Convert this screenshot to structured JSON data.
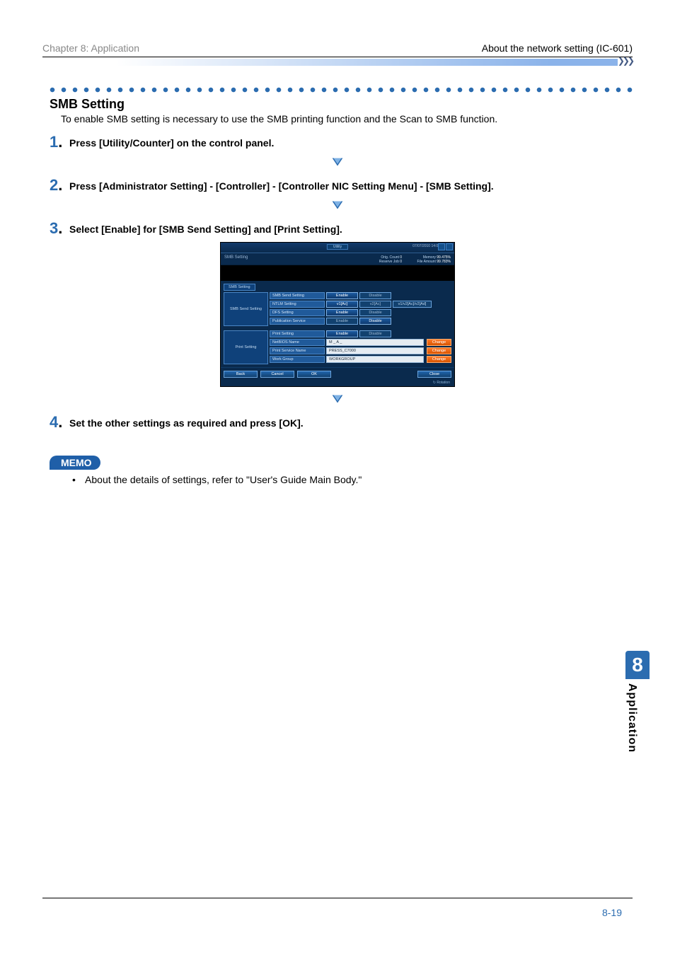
{
  "meta": {
    "chapter_label": "Chapter 8: Application",
    "header_right": "About the network setting (IC-601)"
  },
  "section": {
    "title": "SMB Setting",
    "description": "To enable SMB setting is necessary to use the SMB printing function and the Scan to SMB function."
  },
  "steps": {
    "s1": {
      "n": "1",
      "dot": ".",
      "text": "Press [Utility/Counter] on the control panel."
    },
    "s2": {
      "n": "2",
      "dot": ".",
      "text": "Press [Administrator Setting] - [Controller] - [Controller NIC Setting Menu] - [SMB Setting]."
    },
    "s3": {
      "n": "3",
      "dot": ".",
      "text": "Select [Enable] for [SMB Send Setting] and [Print Setting]."
    },
    "s4": {
      "n": "4",
      "dot": ".",
      "text": "Set the other settings as required and press [OK]."
    }
  },
  "memo": {
    "badge": "MEMO",
    "bullet": "About the details of settings, refer to \"User's Guide Main Body.\""
  },
  "side": {
    "number": "8",
    "label": "Application"
  },
  "footer": {
    "page": "8-19"
  },
  "screenshot": {
    "topbar": {
      "tab": "Utility",
      "date": "07/07/2010 14:00"
    },
    "header": {
      "breadcrumb": "SMB Setting",
      "stats": {
        "r1k": "Orig. Count",
        "r1v1": "0",
        "r1m": "Memory",
        "r1v2": "99.475%",
        "r2k": "Reserve Job",
        "r2v1": "0",
        "r2m": "File Amount",
        "r2v2": "99.783%"
      }
    },
    "left_tab": "SMB Setting",
    "group1": {
      "cap": "SMB Send Setting",
      "rows": {
        "r1": {
          "label": "SMB Send Setting",
          "b1": "Enable",
          "b2": "Disable"
        },
        "r2": {
          "label": "NTLM Setting",
          "b1": "v1[Ac]",
          "b2": "v2[Ac]",
          "b3": "v1/v2[Ac]/v2[Ad]"
        },
        "r3": {
          "label": "DFS Setting",
          "b1": "Enable",
          "b2": "Disable"
        },
        "r4": {
          "label": "Publication Service",
          "b1": "Enable",
          "b2": "Disable"
        }
      }
    },
    "group2": {
      "cap": "Print Setting",
      "rows": {
        "r1": {
          "label": "Print Setting",
          "b1": "Enable",
          "b2": "Disable"
        },
        "r2": {
          "label": "NetBIOS Name",
          "input": "M _ A _",
          "change": "Change"
        },
        "r3": {
          "label": "Print Service Name",
          "input": "PRESS_C7000",
          "change": "Change"
        },
        "r4": {
          "label": "Work Group",
          "input": "WORKGROUP",
          "change": "Change"
        }
      }
    },
    "footer": {
      "back": "Back",
      "cancel": "Cancel",
      "ok": "OK",
      "close": "Close",
      "rotation": "Rotation"
    }
  }
}
